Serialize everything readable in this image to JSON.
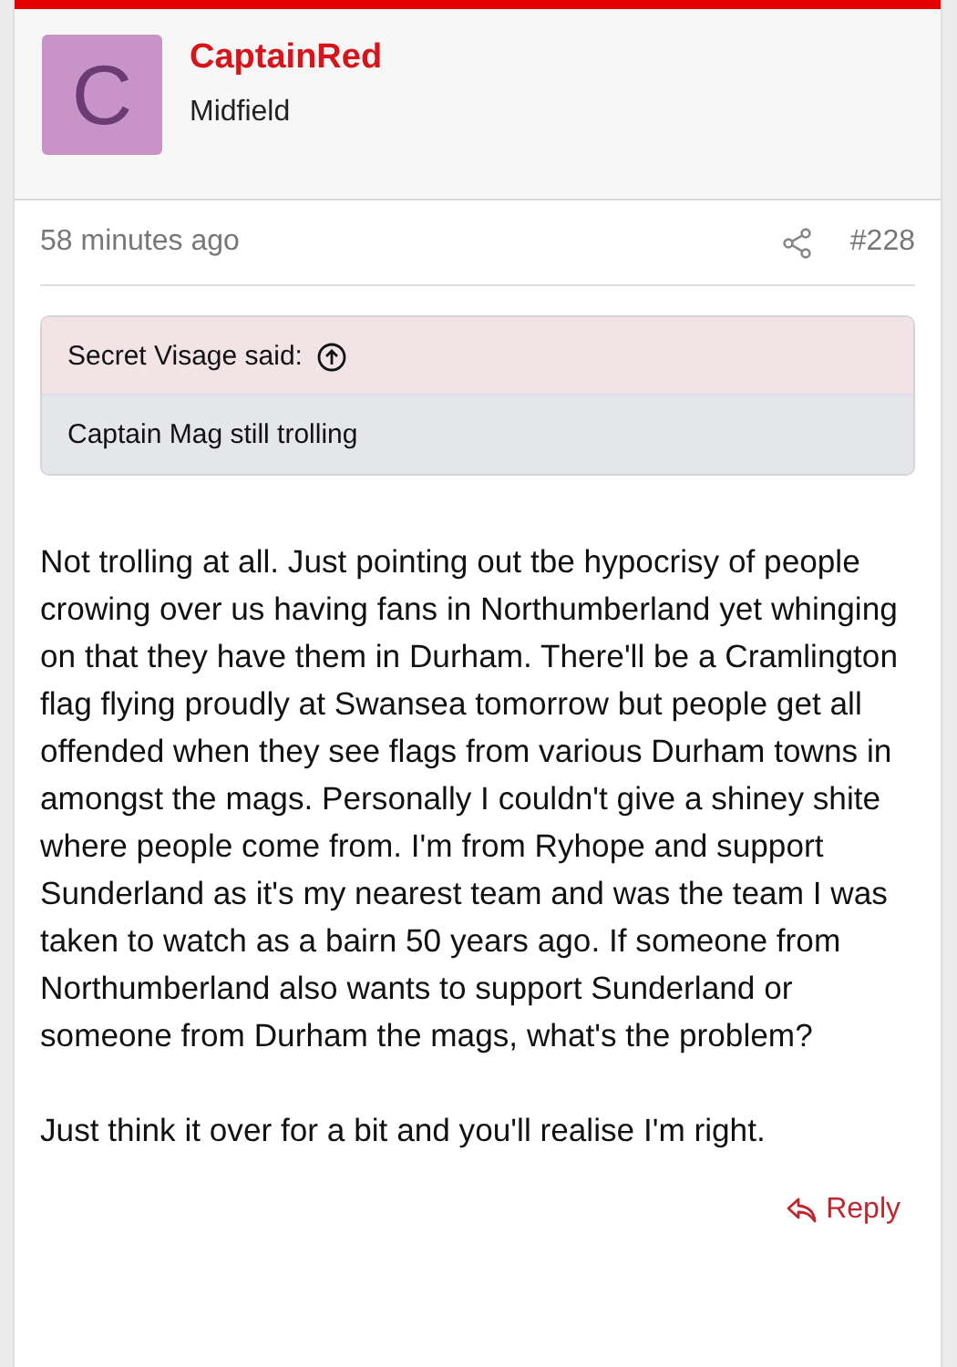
{
  "author": {
    "avatar_letter": "C",
    "name": "CaptainRed",
    "title": "Midfield"
  },
  "meta": {
    "time": "58 minutes ago",
    "post_number": "#228"
  },
  "quote": {
    "attribution": "Secret Visage said:",
    "text": "Captain Mag still trolling"
  },
  "paragraphs": [
    "Not trolling at all. Just pointing out tbe hypocrisy of people crowing over us having fans in Northumberland yet whinging on that they have them in Durham. There'll be a Cramlington flag flying proudly at Swansea tomorrow but people get all offended when they see flags from various Durham towns in amongst the mags. Personally I couldn't give a shiney shite where people come from. I'm from Ryhope and support Sunderland as it's my nearest team and was the team I was taken to watch as a bairn 50 years ago. If someone from Northumberland also wants to support Sunderland or someone from Durham the mags, what's the problem?",
    "Just think it over for a bit and you'll realise I'm right."
  ],
  "actions": {
    "reply": "Reply"
  }
}
